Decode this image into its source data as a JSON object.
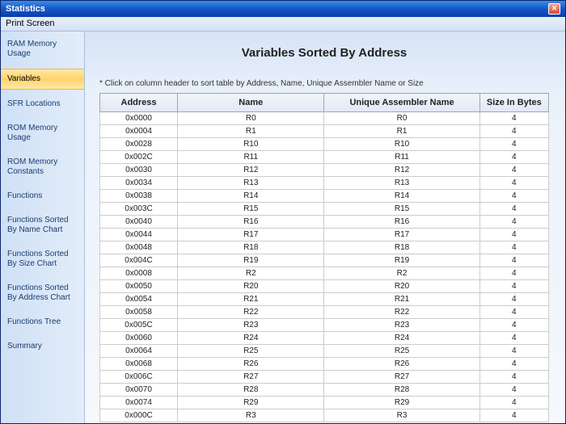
{
  "window": {
    "title": "Statistics"
  },
  "menu": {
    "print_screen": "Print Screen"
  },
  "sidebar": {
    "items": [
      {
        "label": "RAM Memory Usage",
        "active": false
      },
      {
        "label": "Variables",
        "active": true
      },
      {
        "label": "SFR Locations",
        "active": false
      },
      {
        "label": "ROM Memory Usage",
        "active": false
      },
      {
        "label": "ROM Memory Constants",
        "active": false
      },
      {
        "label": "Functions",
        "active": false
      },
      {
        "label": "Functions Sorted By Name Chart",
        "active": false
      },
      {
        "label": "Functions Sorted By Size Chart",
        "active": false
      },
      {
        "label": "Functions Sorted By Address Chart",
        "active": false
      },
      {
        "label": "Functions Tree",
        "active": false
      },
      {
        "label": "Summary",
        "active": false
      }
    ]
  },
  "page": {
    "title": "Variables Sorted By Address",
    "hint": "* Click on column header to sort table by Address, Name, Unique Assembler Name or Size"
  },
  "table": {
    "columns": {
      "address": "Address",
      "name": "Name",
      "uname": "Unique Assembler Name",
      "size": "Size In Bytes"
    },
    "rows": [
      {
        "address": "0x0000",
        "name": "R0",
        "uname": "R0",
        "size": "4"
      },
      {
        "address": "0x0004",
        "name": "R1",
        "uname": "R1",
        "size": "4"
      },
      {
        "address": "0x0028",
        "name": "R10",
        "uname": "R10",
        "size": "4"
      },
      {
        "address": "0x002C",
        "name": "R11",
        "uname": "R11",
        "size": "4"
      },
      {
        "address": "0x0030",
        "name": "R12",
        "uname": "R12",
        "size": "4"
      },
      {
        "address": "0x0034",
        "name": "R13",
        "uname": "R13",
        "size": "4"
      },
      {
        "address": "0x0038",
        "name": "R14",
        "uname": "R14",
        "size": "4"
      },
      {
        "address": "0x003C",
        "name": "R15",
        "uname": "R15",
        "size": "4"
      },
      {
        "address": "0x0040",
        "name": "R16",
        "uname": "R16",
        "size": "4"
      },
      {
        "address": "0x0044",
        "name": "R17",
        "uname": "R17",
        "size": "4"
      },
      {
        "address": "0x0048",
        "name": "R18",
        "uname": "R18",
        "size": "4"
      },
      {
        "address": "0x004C",
        "name": "R19",
        "uname": "R19",
        "size": "4"
      },
      {
        "address": "0x0008",
        "name": "R2",
        "uname": "R2",
        "size": "4"
      },
      {
        "address": "0x0050",
        "name": "R20",
        "uname": "R20",
        "size": "4"
      },
      {
        "address": "0x0054",
        "name": "R21",
        "uname": "R21",
        "size": "4"
      },
      {
        "address": "0x0058",
        "name": "R22",
        "uname": "R22",
        "size": "4"
      },
      {
        "address": "0x005C",
        "name": "R23",
        "uname": "R23",
        "size": "4"
      },
      {
        "address": "0x0060",
        "name": "R24",
        "uname": "R24",
        "size": "4"
      },
      {
        "address": "0x0064",
        "name": "R25",
        "uname": "R25",
        "size": "4"
      },
      {
        "address": "0x0068",
        "name": "R26",
        "uname": "R26",
        "size": "4"
      },
      {
        "address": "0x006C",
        "name": "R27",
        "uname": "R27",
        "size": "4"
      },
      {
        "address": "0x0070",
        "name": "R28",
        "uname": "R28",
        "size": "4"
      },
      {
        "address": "0x0074",
        "name": "R29",
        "uname": "R29",
        "size": "4"
      },
      {
        "address": "0x000C",
        "name": "R3",
        "uname": "R3",
        "size": "4"
      }
    ]
  }
}
